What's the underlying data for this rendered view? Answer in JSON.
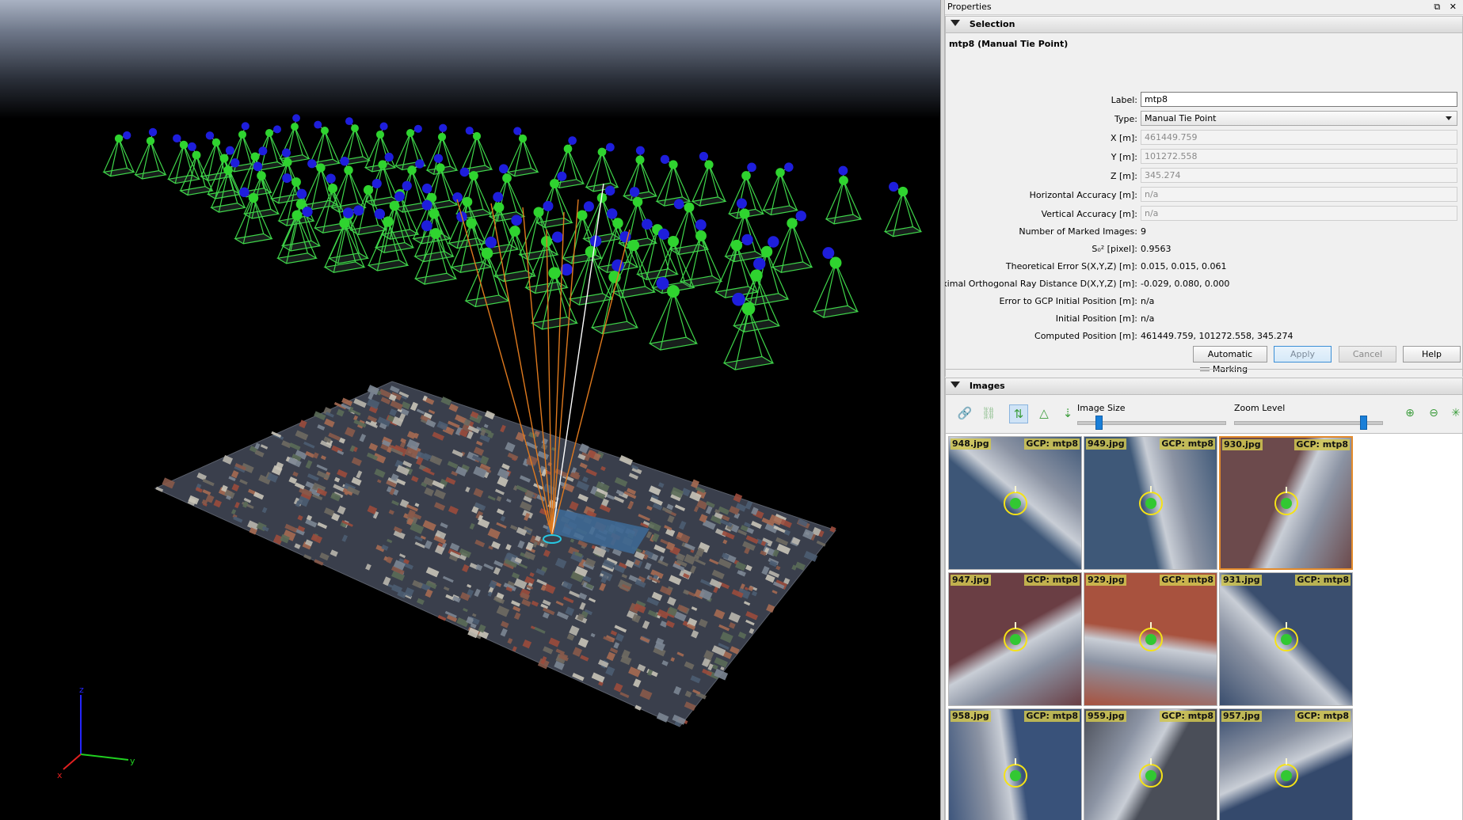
{
  "panel": {
    "title": "Properties",
    "title_buttons": "⧉ ✕"
  },
  "selection": {
    "header": "Selection",
    "object_title": "mtp8 (Manual Tie Point)",
    "label_label": "Label:",
    "label_value": "mtp8",
    "type_label": "Type:",
    "type_value": "Manual Tie Point",
    "x_label": "X [m]:",
    "x_value": "461449.759",
    "y_label": "Y [m]:",
    "y_value": "101272.558",
    "z_label": "Z [m]:",
    "z_value": "345.274",
    "hacc_label": "Horizontal Accuracy [m]:",
    "hacc_value": "n/a",
    "vacc_label": "Vertical Accuracy [m]:",
    "vacc_value": "n/a",
    "rows": [
      {
        "label": "Number of Marked Images:",
        "value": "9"
      },
      {
        "label": "S₀² [pixel]:",
        "value": "0.9563"
      },
      {
        "label": "Theoretical Error S(X,Y,Z) [m]:",
        "value": "0.015, 0.015, 0.061"
      },
      {
        "label": "Maximal Orthogonal Ray Distance D(X,Y,Z) [m]:",
        "value": "-0.029, 0.080, 0.000"
      },
      {
        "label": "Error to GCP Initial Position [m]:",
        "value": "n/a"
      },
      {
        "label": "Initial Position [m]:",
        "value": "n/a"
      },
      {
        "label": "Computed Position [m]:",
        "value": "461449.759, 101272.558, 345.274"
      }
    ],
    "buttons": {
      "automatic_marking": "Automatic Marking",
      "apply": "Apply",
      "cancel": "Cancel",
      "help": "Help"
    }
  },
  "images": {
    "header": "Images",
    "image_size_label": "Image Size",
    "zoom_level_label": "Zoom Level",
    "image_size_value": 0.1,
    "zoom_level_value": 0.85,
    "tools": [
      "link-icon",
      "unlink-icon",
      "sort-vertical-icon",
      "sort-triangle-icon",
      "sort-az-icon",
      "zoom-in-icon",
      "zoom-out-icon",
      "fit-icon"
    ],
    "thumbnails": [
      {
        "file": "948.jpg",
        "gcp": "GCP: mtp8",
        "selected": false,
        "bg": "#3d5677"
      },
      {
        "file": "949.jpg",
        "gcp": "GCP: mtp8",
        "selected": false,
        "bg": "#3e5878"
      },
      {
        "file": "930.jpg",
        "gcp": "GCP: mtp8",
        "selected": true,
        "bg": "#6c4a4c"
      },
      {
        "file": "947.jpg",
        "gcp": "GCP: mtp8",
        "selected": false,
        "bg": "#6a3e44"
      },
      {
        "file": "929.jpg",
        "gcp": "GCP: mtp8",
        "selected": false,
        "bg": "#a8523e"
      },
      {
        "file": "931.jpg",
        "gcp": "GCP: mtp8",
        "selected": false,
        "bg": "#3a4e6e"
      },
      {
        "file": "958.jpg",
        "gcp": "GCP: mtp8",
        "selected": false,
        "bg": "#39527a"
      },
      {
        "file": "959.jpg",
        "gcp": "GCP: mtp8",
        "selected": false,
        "bg": "#4a4e58"
      },
      {
        "file": "957.jpg",
        "gcp": "GCP: mtp8",
        "selected": false,
        "bg": "#34496c"
      }
    ]
  },
  "viewport": {
    "axis_labels": {
      "x": "x",
      "y": "y",
      "z": "z"
    },
    "colors": {
      "camera_frustum": "#3fd64a",
      "camera_center": "#2fd42f",
      "camera_direction": "#1e1edc",
      "ray": "#e07a1e",
      "ray_selected": "#ffffff"
    }
  }
}
